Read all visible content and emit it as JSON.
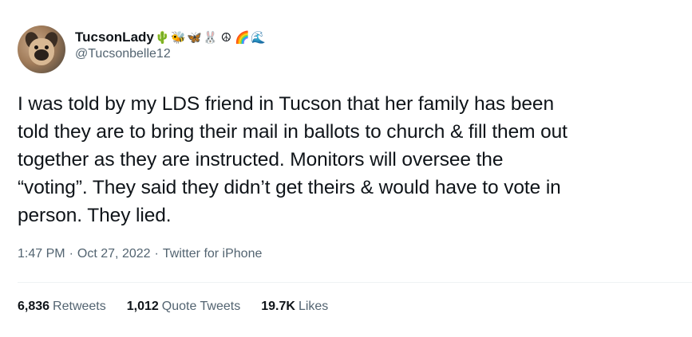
{
  "user": {
    "display_name": "TucsonLady",
    "emojis": [
      "🌵",
      "🐝",
      "🦋",
      "🐰",
      "☮",
      "🌈",
      "🌊"
    ],
    "emoji_names": [
      "cactus-icon",
      "bee-icon",
      "butterfly-icon",
      "rabbit-icon",
      "peace-icon",
      "rainbow-icon",
      "wave-icon"
    ],
    "handle": "@Tucsonbelle12"
  },
  "tweet": {
    "text": "I was told by my LDS friend in Tucson that her family has  been\ntold they are to bring their mail in ballots to church & fill them out\ntogether as they are instructed. Monitors will oversee the\n“voting”. They said they didn’t get theirs & would have to vote in\nperson. They lied."
  },
  "meta": {
    "time": "1:47 PM",
    "separator": "·",
    "date": "Oct 27, 2022",
    "source": "Twitter for iPhone"
  },
  "stats": {
    "retweets_count": "6,836",
    "retweets_label": "Retweets",
    "quotes_count": "1,012",
    "quotes_label": "Quote Tweets",
    "likes_count": "19.7K",
    "likes_label": "Likes"
  },
  "colors": {
    "text": "#0f1419",
    "secondary": "#536471",
    "divider": "#eff3f4"
  }
}
